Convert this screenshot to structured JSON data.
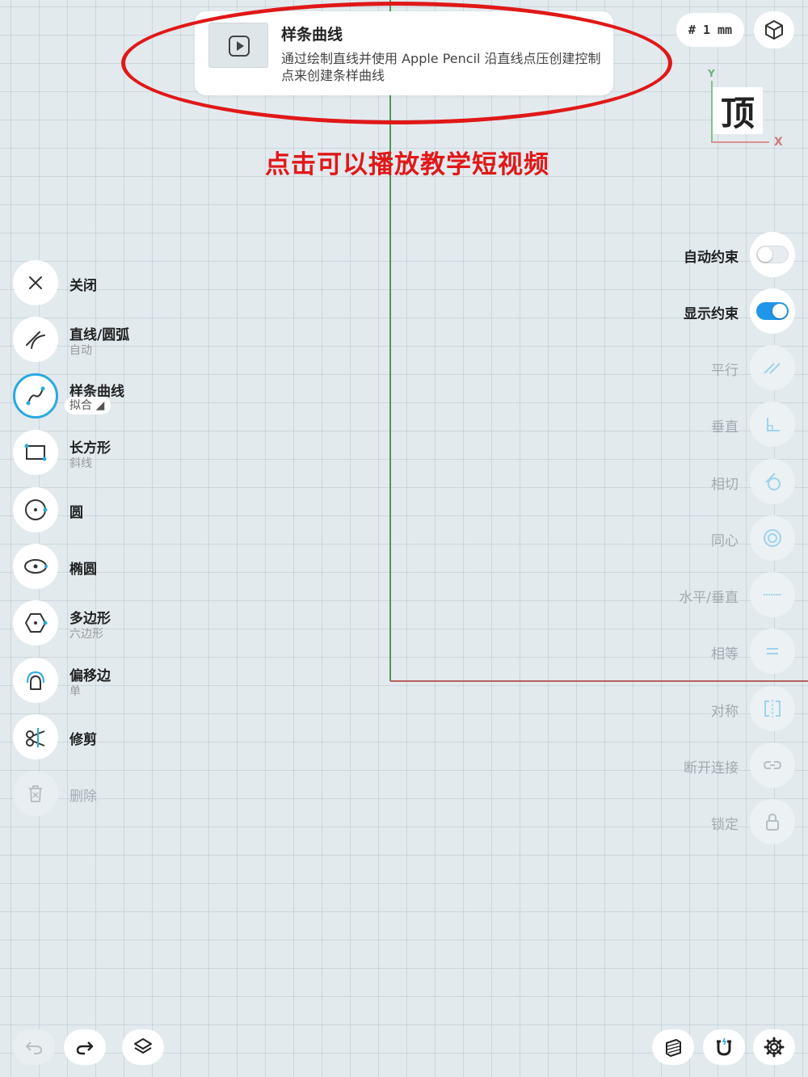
{
  "tutorial": {
    "title": "样条曲线",
    "description": "通过绘制直线并使用 Apple Pencil 沿直线点压创建控制点来创建条样曲线",
    "annotation": "点击可以播放教学短视频"
  },
  "top_right": {
    "grid_unit": "# 1 mm",
    "view_label": "顶",
    "axis_y": "Y",
    "axis_x": "X"
  },
  "tools": [
    {
      "label": "关闭",
      "icon": "close-icon"
    },
    {
      "label": "直线/圆弧",
      "sub": "自动",
      "icon": "line-arc-icon"
    },
    {
      "label": "样条曲线",
      "sub": "拟合",
      "icon": "spline-icon",
      "active": true
    },
    {
      "label": "长方形",
      "sub": "斜线",
      "icon": "rectangle-icon"
    },
    {
      "label": "圆",
      "icon": "circle-icon"
    },
    {
      "label": "椭圆",
      "icon": "ellipse-icon"
    },
    {
      "label": "多边形",
      "sub": "六边形",
      "icon": "polygon-icon"
    },
    {
      "label": "偏移边",
      "sub": "单",
      "icon": "offset-icon"
    },
    {
      "label": "修剪",
      "icon": "scissors-icon"
    },
    {
      "label": "删除",
      "icon": "trash-icon",
      "disabled": true
    }
  ],
  "constraints": {
    "auto_constraint": {
      "label": "自动约束",
      "on": false
    },
    "show_constraint": {
      "label": "显示约束",
      "on": true
    },
    "items": [
      {
        "label": "平行",
        "icon": "parallel-icon"
      },
      {
        "label": "垂直",
        "icon": "perpendicular-icon"
      },
      {
        "label": "相切",
        "icon": "tangent-icon"
      },
      {
        "label": "同心",
        "icon": "concentric-icon"
      },
      {
        "label": "水平/垂直",
        "icon": "horizontal-vertical-icon"
      },
      {
        "label": "相等",
        "icon": "equal-icon"
      },
      {
        "label": "对称",
        "icon": "symmetric-icon"
      },
      {
        "label": "断开连接",
        "icon": "disconnect-icon"
      },
      {
        "label": "锁定",
        "icon": "lock-icon"
      }
    ]
  },
  "bottom": {
    "undo_icon": "undo-icon",
    "redo_icon": "redo-icon",
    "layers_icon": "layers-icon",
    "section_icon": "section-view-icon",
    "snap_icon": "magnet-icon",
    "settings_icon": "settings-gear-icon"
  },
  "colors": {
    "accent": "#29a9e0",
    "toggle_on": "#2196e8",
    "annotation_red": "#e01818",
    "axis_green": "#4c9a5a",
    "axis_red": "#b8605e"
  }
}
